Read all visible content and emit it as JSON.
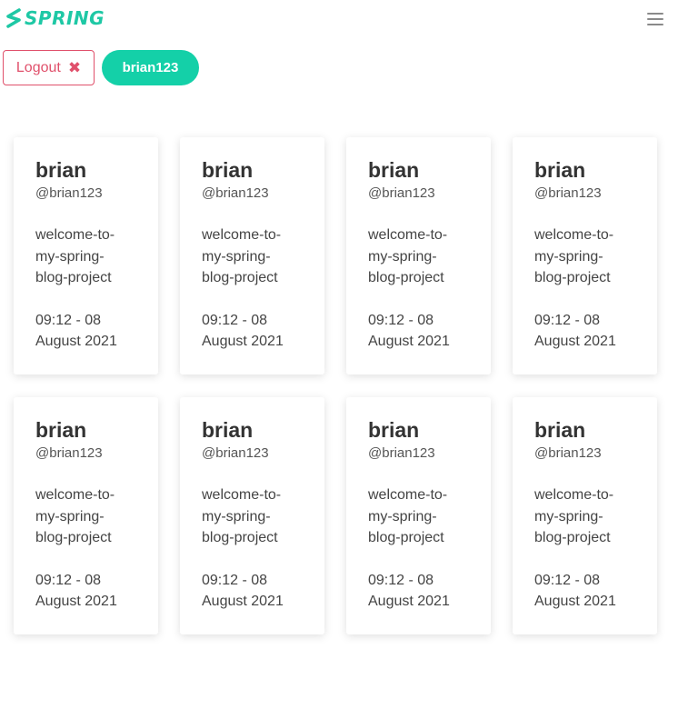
{
  "brand": {
    "name": "SPRING",
    "color": "#1ec8a5"
  },
  "navbar": {
    "menu_icon": "hamburger-menu-icon"
  },
  "toolbar": {
    "logout_label": "Logout",
    "logout_icon": "close-icon",
    "logout_color": "#e0506b",
    "user_label": "brian123",
    "user_color": "#14d0a8"
  },
  "posts": [
    {
      "name": "brian",
      "handle": "@brian123",
      "title": "welcome-to-my-spring-blog-project",
      "date": "09:12 - 08 August 2021"
    },
    {
      "name": "brian",
      "handle": "@brian123",
      "title": "welcome-to-my-spring-blog-project",
      "date": "09:12 - 08 August 2021"
    },
    {
      "name": "brian",
      "handle": "@brian123",
      "title": "welcome-to-my-spring-blog-project",
      "date": "09:12 - 08 August 2021"
    },
    {
      "name": "brian",
      "handle": "@brian123",
      "title": "welcome-to-my-spring-blog-project",
      "date": "09:12 - 08 August 2021"
    },
    {
      "name": "brian",
      "handle": "@brian123",
      "title": "welcome-to-my-spring-blog-project",
      "date": "09:12 - 08 August 2021"
    },
    {
      "name": "brian",
      "handle": "@brian123",
      "title": "welcome-to-my-spring-blog-project",
      "date": "09:12 - 08 August 2021"
    },
    {
      "name": "brian",
      "handle": "@brian123",
      "title": "welcome-to-my-spring-blog-project",
      "date": "09:12 - 08 August 2021"
    },
    {
      "name": "brian",
      "handle": "@brian123",
      "title": "welcome-to-my-spring-blog-project",
      "date": "09:12 - 08 August 2021"
    }
  ]
}
